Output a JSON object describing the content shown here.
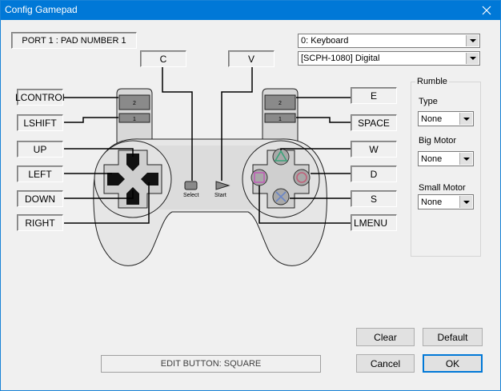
{
  "window": {
    "title": "Config Gamepad",
    "close_glyph": "✕"
  },
  "port_label": "PORT 1 : PAD NUMBER 1",
  "device_select": {
    "value": "0: Keyboard"
  },
  "pad_type_select": {
    "value": "[SCPH-1080] Digital"
  },
  "bindings": {
    "select": "C",
    "start": "V",
    "l2": "LCONTROI",
    "l1": "LSHIFT",
    "up": "UP",
    "left": "LEFT",
    "down": "DOWN",
    "right": "RIGHT",
    "r2": "E",
    "r1": "SPACE",
    "triangle": "W",
    "circle": "D",
    "cross": "S",
    "square": "LMENU"
  },
  "pad_labels": {
    "select": "Select",
    "start": "Start",
    "l2": "2",
    "l1": "1",
    "r2": "2",
    "r1": "1"
  },
  "rumble": {
    "group_title": "Rumble",
    "type_label": "Type",
    "type_value": "None",
    "big_motor_label": "Big Motor",
    "big_motor_value": "None",
    "small_motor_label": "Small Motor",
    "small_motor_value": "None"
  },
  "status_text": "EDIT BUTTON: SQUARE",
  "buttons": {
    "clear": "Clear",
    "default": "Default",
    "cancel": "Cancel",
    "ok": "OK"
  },
  "colors": {
    "titlebar": "#0078d7",
    "triangle": "#3aa37a",
    "circle": "#c0607a",
    "cross": "#6b86c6",
    "square": "#c060b8"
  }
}
